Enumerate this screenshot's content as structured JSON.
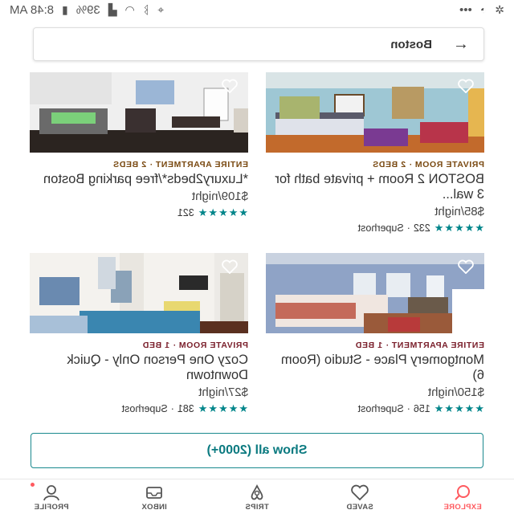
{
  "status_bar": {
    "time": "8:48 AM",
    "battery": "39%",
    "overflow": "•••"
  },
  "search": {
    "query": "Boston",
    "back_icon": "arrow-left-icon"
  },
  "listings": [
    {
      "kind": "PRIVATE ROOM · 2 BEDS",
      "title": "BOSTON 2 Room + private bath for 3 wal...",
      "price": "$85/night",
      "rating_stars": 5,
      "reviews": "232",
      "superhost": "Superhost"
    },
    {
      "kind": "ENTIRE APARTMENT · 2 BEDS",
      "title": "*Luxury2beds*/free parking Boston",
      "price": "$109/night",
      "rating_stars": 5,
      "reviews": "321",
      "superhost": ""
    },
    {
      "kind": "ENTIRE APARTMENT · 1 BED",
      "title": "Montgomery Place - Studio (Room 6)",
      "price": "$150/night",
      "rating_stars": 5,
      "reviews": "156",
      "superhost": "Superhost"
    },
    {
      "kind": "PRIVATE ROOM · 1 BED",
      "title": "Cozy One Person Only - Quick Downtown",
      "price": "$27/night",
      "rating_stars": 5,
      "reviews": "381",
      "superhost": "Superhost"
    }
  ],
  "show_all": {
    "label": "Show all (2000+)"
  },
  "tabs": [
    {
      "label": "EXPLORE",
      "icon": "search-icon",
      "active": true
    },
    {
      "label": "SAVED",
      "icon": "heart-icon",
      "active": false
    },
    {
      "label": "TRIPS",
      "icon": "airbnb-logo-icon",
      "active": false
    },
    {
      "label": "INBOX",
      "icon": "inbox-icon",
      "active": false
    },
    {
      "label": "PROFILE",
      "icon": "profile-icon",
      "active": false,
      "notification": true
    }
  ],
  "colors": {
    "accent": "#ff5a5f",
    "teal": "#00858a"
  }
}
